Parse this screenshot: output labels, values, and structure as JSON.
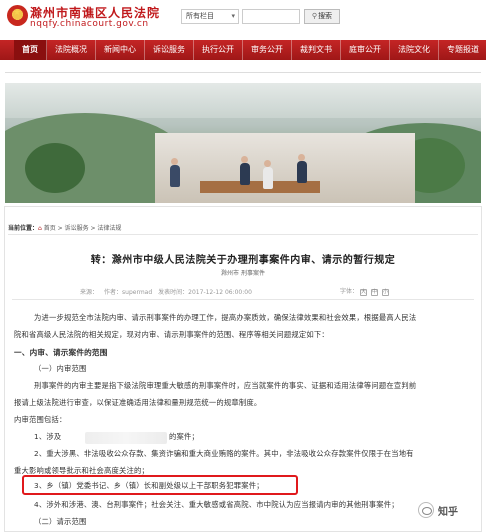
{
  "header": {
    "site_title": "滁州市南谯区人民法院",
    "site_url": "nqqfy.chinacourt.gov.cn",
    "search_scope": "所有栏目",
    "search_button": "搜索"
  },
  "nav": {
    "items": [
      "首页",
      "法院概况",
      "新闻中心",
      "诉讼服务",
      "执行公开",
      "审务公开",
      "裁判文书",
      "庭审公开",
      "法院文化",
      "专题报道"
    ]
  },
  "breadcrumb": {
    "label": "当前位置：",
    "path": "首页 > 诉讼服务 > 法律法规"
  },
  "article": {
    "title": "转：滁州市中级人民法院关于办理刑事案件内审、请示的暂行规定",
    "source": "滁州市 刑事案件",
    "meta": {
      "source_label": "来源：",
      "author_label": "作者：",
      "author": "supermad",
      "time_label": "发表时间：",
      "time": "2017-12-12 06:00:00"
    },
    "font_size": {
      "label": "字体：",
      "options": [
        "大",
        "中",
        "小"
      ]
    },
    "paragraphs": [
      "为进一步规范全市法院内审、请示刑事案件的办理工作，提高办案质效，确保法律效果和社会效果，根据最高人民法",
      "院和省高级人民法院的相关规定，现对内审、请示刑事案件的范围、程序等相关问题规定如下：",
      "一、内审、请示案件的范围",
      "（一）内审范围",
      "刑事案件的内审主要是指下级法院审理重大敏感的刑事案件时，应当就案件的事实、证据和适用法律等问题在宣判前",
      "报请上级法院进行审查，以保证准确适用法律和量刑规范统一的规章制度。",
      "内审范围包括：",
      "1、涉及",
      "的案件；",
      "2、重大涉黑、非法吸收公众存款、集资诈骗和重大商业贿赂的案件。其中，非法吸收公众存款案件仅限于在当地有",
      "重大影响或领导批示和社会高度关注的；",
      "3、乡（镇）党委书记、乡（镇）长和副处级以上干部职务犯罪案件；",
      "4、涉外和涉港、澳、台刑事案件；社会关注、重大敏感或省高院、市中院认为应当报请内审的其他刑事案件；",
      "（二）请示范围"
    ]
  },
  "watermark": {
    "text": "知乎"
  },
  "colors": {
    "brand_red": "#b31e1e",
    "highlight_red": "#e0191c"
  }
}
